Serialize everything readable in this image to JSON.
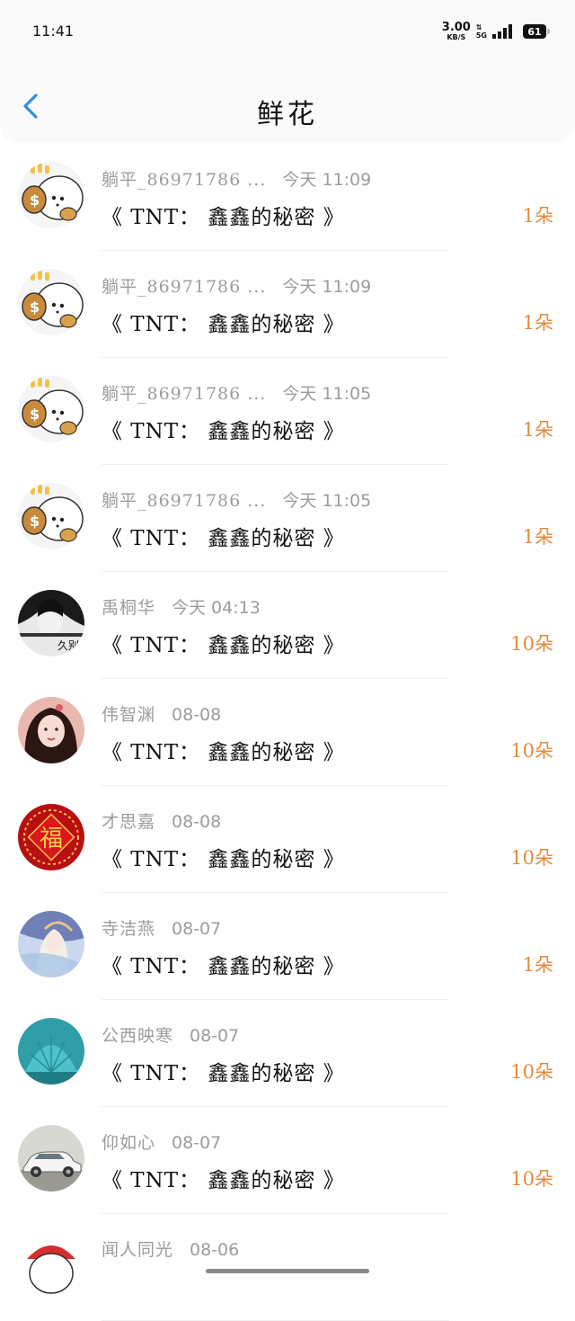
{
  "status": {
    "time": "11:41",
    "net_speed": "3.00",
    "net_unit": "KB/S",
    "network": "5G",
    "battery": "61"
  },
  "header": {
    "title": "鲜花"
  },
  "rows": [
    {
      "sender": "躺平_86971786 ...",
      "time": "今天 11:09",
      "work": "《 TNT： 鑫鑫的秘密 》",
      "count": "1朵",
      "avatar": "cartoon-money-bag-avatar"
    },
    {
      "sender": "躺平_86971786 ...",
      "time": "今天 11:09",
      "work": "《 TNT： 鑫鑫的秘密 》",
      "count": "1朵",
      "avatar": "cartoon-money-bag-avatar"
    },
    {
      "sender": "躺平_86971786 ...",
      "time": "今天 11:05",
      "work": "《 TNT： 鑫鑫的秘密 》",
      "count": "1朵",
      "avatar": "cartoon-money-bag-avatar"
    },
    {
      "sender": "躺平_86971786 ...",
      "time": "今天 11:05",
      "work": "《 TNT： 鑫鑫的秘密 》",
      "count": "1朵",
      "avatar": "cartoon-money-bag-avatar"
    },
    {
      "sender": "禹桐华",
      "time": "今天 04:13",
      "work": "《 TNT： 鑫鑫的秘密 》",
      "count": "10朵",
      "avatar": "dark-portrait-avatar"
    },
    {
      "sender": "伟智渊",
      "time": "08-08",
      "work": "《 TNT： 鑫鑫的秘密 》",
      "count": "10朵",
      "avatar": "girl-photo-avatar"
    },
    {
      "sender": "才思嘉",
      "time": "08-08",
      "work": "《 TNT： 鑫鑫的秘密 》",
      "count": "10朵",
      "avatar": "fu-character-avatar"
    },
    {
      "sender": "寺洁燕",
      "time": "08-07",
      "work": "《 TNT： 鑫鑫的秘密 》",
      "count": "1朵",
      "avatar": "anime-painting-avatar"
    },
    {
      "sender": "公西映寒",
      "time": "08-07",
      "work": "《 TNT： 鑫鑫的秘密 》",
      "count": "10朵",
      "avatar": "teal-shell-avatar"
    },
    {
      "sender": "仰如心",
      "time": "08-07",
      "work": "《 TNT： 鑫鑫的秘密 》",
      "count": "10朵",
      "avatar": "white-car-avatar"
    },
    {
      "sender": "闻人同光",
      "time": "08-06",
      "work": "",
      "count": "",
      "avatar": "red-cartoon-avatar"
    }
  ]
}
